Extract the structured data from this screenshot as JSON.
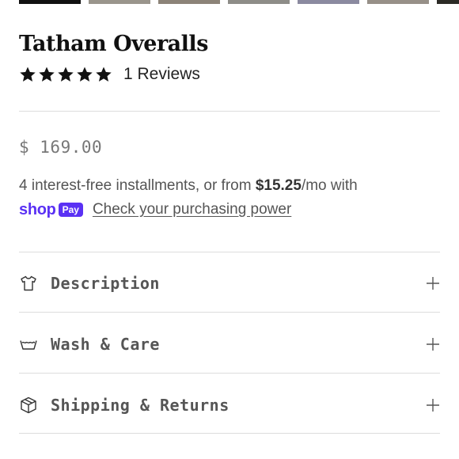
{
  "gallery": {
    "thumbnails": [
      {
        "color": "#111111",
        "active": true
      },
      {
        "color": "#9a958c",
        "active": false
      },
      {
        "color": "#8c8378",
        "active": false
      },
      {
        "color": "#8e8d88",
        "active": false
      },
      {
        "color": "#8b8aa0",
        "active": false
      },
      {
        "color": "#979088",
        "active": false
      },
      {
        "color": "#2c2b26",
        "active": false
      }
    ]
  },
  "product": {
    "title": "Tatham Overalls",
    "rating": 5,
    "reviews_label": "1 Reviews",
    "price": "$ 169.00"
  },
  "installments": {
    "text_before": "4 interest-free installments, or from ",
    "amount": "$15.25",
    "text_after": "/mo with",
    "shop_word": "shop",
    "pay_badge": "Pay",
    "link_label": "Check your purchasing power",
    "brand_color": "#5a31f4"
  },
  "accordion": [
    {
      "label": "Description",
      "icon": "tshirt-icon"
    },
    {
      "label": "Wash & Care",
      "icon": "wash-basin-icon"
    },
    {
      "label": "Shipping & Returns",
      "icon": "package-box-icon"
    }
  ]
}
